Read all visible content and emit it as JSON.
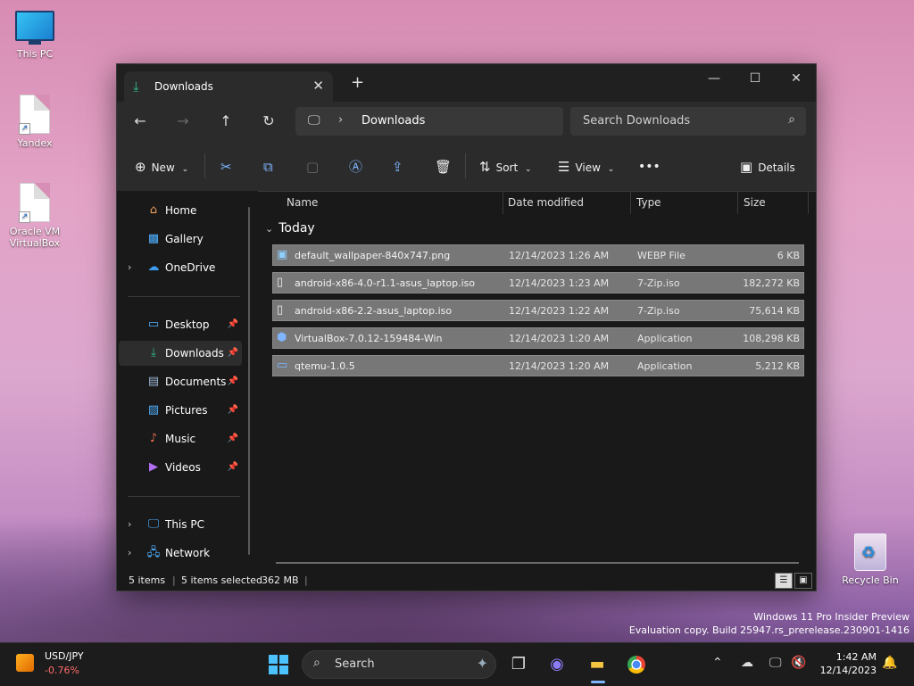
{
  "desktop": {
    "icons": [
      {
        "label": "This PC",
        "icon": "computer-icon"
      },
      {
        "label": "Yandex",
        "icon": "file-shortcut-icon"
      },
      {
        "label_line1": "Oracle VM",
        "label_line2": "VirtualBox",
        "icon": "file-shortcut-icon"
      },
      {
        "label": "Recycle Bin",
        "icon": "recycle-bin-icon"
      }
    ],
    "watermark": {
      "line1": "Windows 11 Pro Insider Preview",
      "line2": "Evaluation copy. Build 25947.rs_prerelease.230901-1416"
    }
  },
  "window": {
    "tab_title": "Downloads",
    "new_tab": "+",
    "controls": {
      "minimize": "—",
      "maximize": "☐",
      "close": "✕"
    },
    "address": {
      "location": "Downloads"
    },
    "search": {
      "placeholder": "Search Downloads"
    },
    "toolbar": {
      "new": "New",
      "sort": "Sort",
      "view": "View",
      "more": "•••",
      "details": "Details"
    },
    "sidebar": {
      "items": [
        {
          "label": "Home",
          "icon": "home-icon"
        },
        {
          "label": "Gallery",
          "icon": "gallery-icon"
        },
        {
          "label": "OneDrive",
          "icon": "cloud-icon"
        },
        {
          "label": "Desktop",
          "icon": "desktop-icon",
          "pinned": true
        },
        {
          "label": "Downloads",
          "icon": "download-icon",
          "pinned": true,
          "selected": true
        },
        {
          "label": "Documents",
          "icon": "documents-icon",
          "pinned": true
        },
        {
          "label": "Pictures",
          "icon": "pictures-icon",
          "pinned": true
        },
        {
          "label": "Music",
          "icon": "music-icon",
          "pinned": true
        },
        {
          "label": "Videos",
          "icon": "videos-icon",
          "pinned": true
        },
        {
          "label": "This PC",
          "icon": "computer-icon"
        },
        {
          "label": "Network",
          "icon": "network-icon"
        }
      ]
    },
    "columns": {
      "name": "Name",
      "date": "Date modified",
      "type": "Type",
      "size": "Size"
    },
    "group": "Today",
    "files": [
      {
        "name": "default_wallpaper-840x747.png",
        "date": "12/14/2023 1:26 AM",
        "type": "WEBP File",
        "size": "6 KB",
        "icon": "image-file-icon"
      },
      {
        "name": "android-x86-4.0-r1.1-asus_laptop.iso",
        "date": "12/14/2023 1:23 AM",
        "type": "7-Zip.iso",
        "size": "182,272 KB",
        "icon": "file-icon"
      },
      {
        "name": "android-x86-2.2-asus_laptop.iso",
        "date": "12/14/2023 1:22 AM",
        "type": "7-Zip.iso",
        "size": "75,614 KB",
        "icon": "file-icon"
      },
      {
        "name": "VirtualBox-7.0.12-159484-Win",
        "date": "12/14/2023 1:20 AM",
        "type": "Application",
        "size": "108,298 KB",
        "icon": "virtualbox-icon"
      },
      {
        "name": "qtemu-1.0.5",
        "date": "12/14/2023 1:20 AM",
        "type": "Application",
        "size": "5,212 KB",
        "icon": "app-icon"
      }
    ],
    "status": {
      "items": "5 items",
      "selected": "5 items selected",
      "size": "362 MB"
    }
  },
  "taskbar": {
    "widget": {
      "title": "USD/JPY",
      "value": "-0.76%"
    },
    "search_label": "Search",
    "clock": {
      "time": "1:42 AM",
      "date": "12/14/2023"
    }
  },
  "colors": {
    "accent": "#7fb6ff",
    "downloads_green": "#33c28a",
    "negative": "#ff6b6b"
  }
}
